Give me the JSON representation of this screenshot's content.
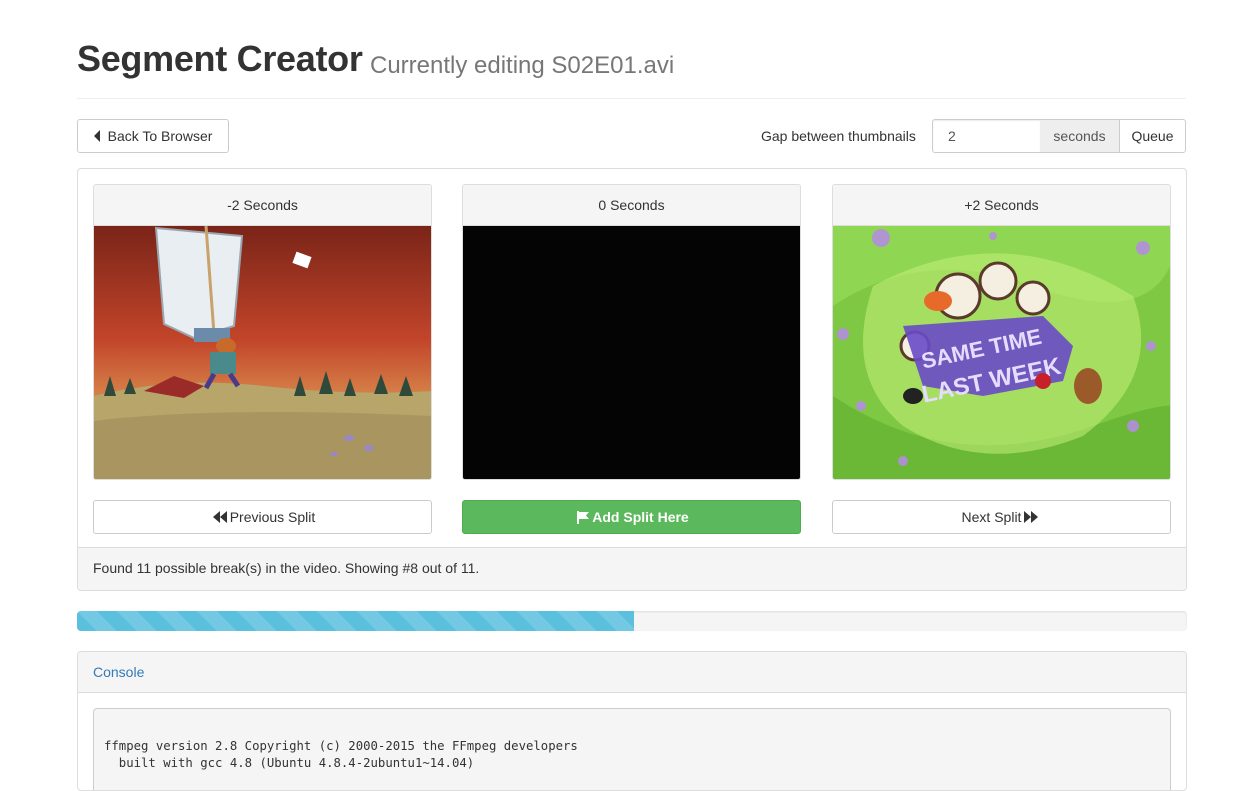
{
  "header": {
    "title": "Segment Creator",
    "subtitle": "Currently editing S02E01.avi"
  },
  "toolbar": {
    "back_label": "Back To Browser",
    "gap_label": "Gap between thumbnails",
    "gap_value": "2",
    "gap_unit": "seconds",
    "queue_label": "Queue"
  },
  "thumbnails": [
    {
      "label": "-2 Seconds"
    },
    {
      "label": "0 Seconds"
    },
    {
      "label": "+2 Seconds"
    }
  ],
  "actions": {
    "previous_label": "Previous Split",
    "add_label": "Add Split Here",
    "next_label": "Next Split"
  },
  "status": {
    "text": "Found 11 possible break(s) in the video. Showing #8 out of 11."
  },
  "progress": {
    "percent": 50.2
  },
  "console": {
    "title": "Console",
    "lines": [
      "ffmpeg version 2.8 Copyright (c) 2000-2015 the FFmpeg developers",
      "  built with gcc 4.8 (Ubuntu 4.8.4-2ubuntu1~14.04)"
    ]
  },
  "colors": {
    "accent_success": "#5cb85c",
    "progress_info": "#5bc0de",
    "link": "#337ab7"
  }
}
